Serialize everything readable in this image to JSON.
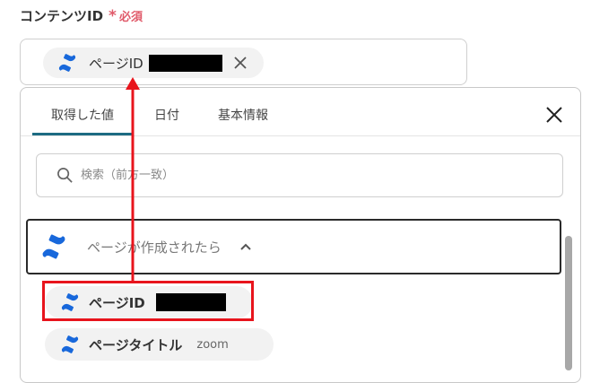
{
  "field": {
    "label": "コンテンツID",
    "required_mark": "*",
    "required_text": "必須"
  },
  "selected_chip": {
    "icon": "confluence-logo-icon",
    "label": "ページID"
  },
  "dropdown": {
    "tabs": [
      {
        "label": "取得した値",
        "active": true
      },
      {
        "label": "日付",
        "active": false
      },
      {
        "label": "基本情報",
        "active": false
      }
    ],
    "search_placeholder": "検索（前方一致）",
    "group": {
      "icon": "confluence-logo-icon",
      "label": "ページが作成されたら",
      "expanded": true
    },
    "items": [
      {
        "icon": "confluence-logo-icon",
        "label": "ページID",
        "value_redacted": true
      },
      {
        "icon": "confluence-logo-icon",
        "label": "ページタイトル",
        "value": "zoom"
      }
    ]
  },
  "colors": {
    "accent": "#1d6b82",
    "required": "#e05a6a",
    "annotation": "#e8141c",
    "confluence_blue": "#1868db"
  }
}
